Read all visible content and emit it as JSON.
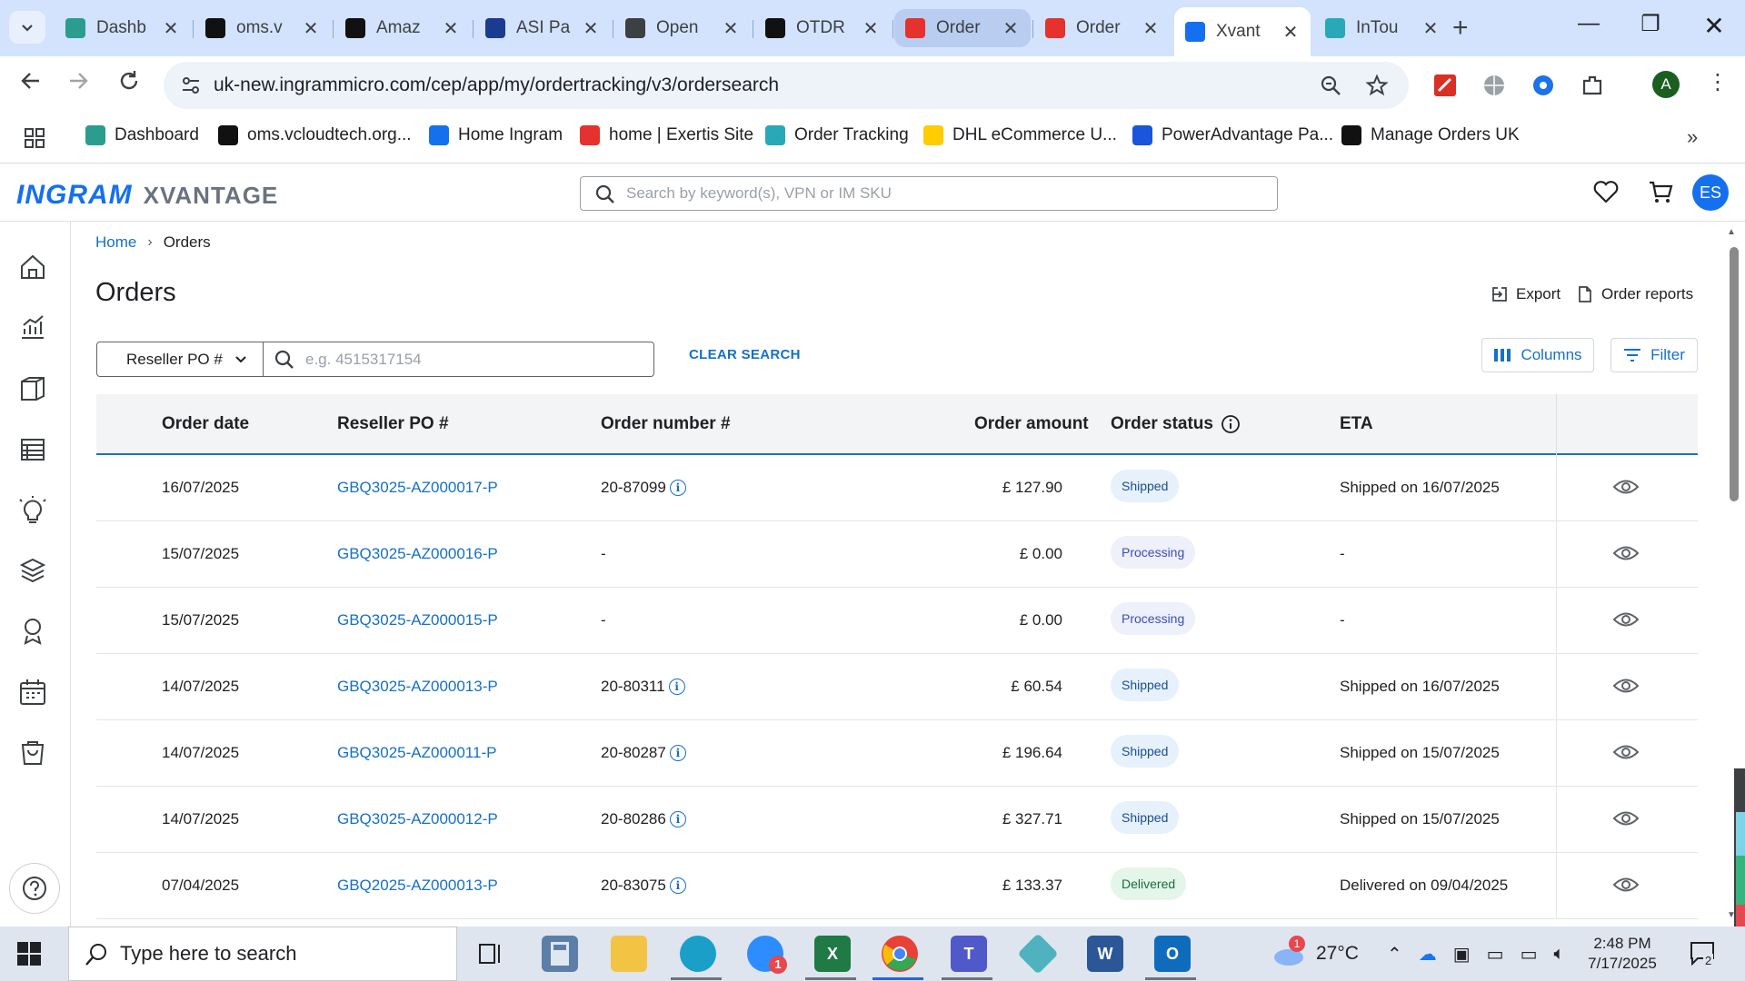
{
  "browser": {
    "tabs": [
      {
        "label": "Dashb",
        "icon": "dashboard-icon",
        "color": "#2a9d8f"
      },
      {
        "label": "oms.v",
        "icon": "oms-icon",
        "color": "#111111"
      },
      {
        "label": "Amaz",
        "icon": "amazon-icon",
        "color": "#111111"
      },
      {
        "label": "ASI Pa",
        "icon": "asi-icon",
        "color": "#1a3c8e"
      },
      {
        "label": "Open",
        "icon": "openai-icon",
        "color": "#3c4043"
      },
      {
        "label": "OTDR",
        "icon": "openai-icon",
        "color": "#111111"
      },
      {
        "label": "Order",
        "icon": "exertis-icon",
        "color": "#e5322d"
      },
      {
        "label": "Order",
        "icon": "exertis-icon",
        "color": "#e5322d"
      },
      {
        "label": "Xvant",
        "icon": "ingram-icon",
        "color": "#1570ef"
      },
      {
        "label": "InTou",
        "icon": "intouch-icon",
        "color": "#29a8b8"
      }
    ],
    "url": "uk-new.ingrammicro.com/cep/app/my/ordertracking/v3/ordersearch",
    "profile_initial": "A",
    "bookmarks": [
      {
        "label": "Dashboard",
        "color": "#2a9d8f"
      },
      {
        "label": "oms.vcloudtech.org...",
        "color": "#111111"
      },
      {
        "label": "Home Ingram",
        "color": "#1570ef"
      },
      {
        "label": "home | Exertis Site",
        "color": "#e5322d"
      },
      {
        "label": "Order Tracking",
        "color": "#29a8b8"
      },
      {
        "label": "DHL eCommerce U...",
        "color": "#ffcc00"
      },
      {
        "label": "PowerAdvantage Pa...",
        "color": "#1a56db"
      },
      {
        "label": "Manage Orders UK",
        "color": "#111111"
      }
    ]
  },
  "app": {
    "logo_primary": "INGRAM",
    "logo_secondary": "XVANTAGE",
    "search_placeholder": "Search by keyword(s), VPN or IM SKU",
    "user_initials": "ES",
    "accent": "#1570c8"
  },
  "page": {
    "breadcrumb": [
      "Home",
      "Orders"
    ],
    "title": "Orders",
    "export_label": "Export",
    "reports_label": "Order reports",
    "filter_field": "Reseller PO #",
    "filter_placeholder": "e.g. 4515317154",
    "clear_label": "CLEAR SEARCH",
    "columns_label": "Columns",
    "filter_label": "Filter"
  },
  "table": {
    "headers": {
      "date": "Order date",
      "po": "Reseller PO #",
      "number": "Order number #",
      "amount": "Order amount",
      "status": "Order status",
      "eta": "ETA"
    },
    "rows": [
      {
        "date": "16/07/2025",
        "po": "GBQ3025-AZ000017-P",
        "number": "20-87099",
        "amount": "£ 127.90",
        "status": "Shipped",
        "status_kind": "shipped",
        "eta": "Shipped on 16/07/2025"
      },
      {
        "date": "15/07/2025",
        "po": "GBQ3025-AZ000016-P",
        "number": "-",
        "amount": "£ 0.00",
        "status": "Processing",
        "status_kind": "processing",
        "eta": "-"
      },
      {
        "date": "15/07/2025",
        "po": "GBQ3025-AZ000015-P",
        "number": "-",
        "amount": "£ 0.00",
        "status": "Processing",
        "status_kind": "processing",
        "eta": "-"
      },
      {
        "date": "14/07/2025",
        "po": "GBQ3025-AZ000013-P",
        "number": "20-80311",
        "amount": "£ 60.54",
        "status": "Shipped",
        "status_kind": "shipped",
        "eta": "Shipped on 16/07/2025"
      },
      {
        "date": "14/07/2025",
        "po": "GBQ3025-AZ000011-P",
        "number": "20-80287",
        "amount": "£ 196.64",
        "status": "Shipped",
        "status_kind": "shipped",
        "eta": "Shipped on 15/07/2025"
      },
      {
        "date": "14/07/2025",
        "po": "GBQ3025-AZ000012-P",
        "number": "20-80286",
        "amount": "£ 327.71",
        "status": "Shipped",
        "status_kind": "shipped",
        "eta": "Shipped on 15/07/2025"
      },
      {
        "date": "07/04/2025",
        "po": "GBQ2025-AZ000013-P",
        "number": "20-83075",
        "amount": "£ 133.37",
        "status": "Delivered",
        "status_kind": "delivered",
        "eta": "Delivered on 09/04/2025"
      }
    ]
  },
  "taskbar": {
    "search_placeholder": "Type here to search",
    "weather": "27°C",
    "weather_badge": "1",
    "zoom_badge": "1",
    "time": "2:48 PM",
    "date": "7/17/2025",
    "notifications": "2"
  }
}
